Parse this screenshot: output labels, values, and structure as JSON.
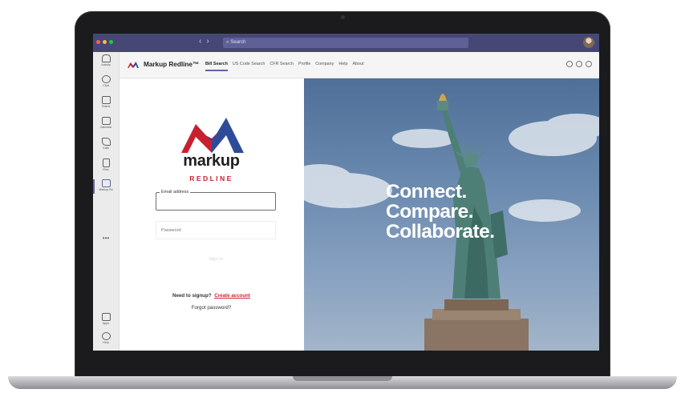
{
  "window": {
    "search_placeholder": "Search"
  },
  "rail": {
    "items": [
      {
        "label": "Activity",
        "icon": "bell-icon"
      },
      {
        "label": "Chat",
        "icon": "chat-icon"
      },
      {
        "label": "Teams",
        "icon": "teams-icon"
      },
      {
        "label": "Calendar",
        "icon": "calendar-icon"
      },
      {
        "label": "Calls",
        "icon": "phone-icon"
      },
      {
        "label": "Files",
        "icon": "file-icon"
      },
      {
        "label": "Markup Re",
        "icon": "markup-app-icon"
      }
    ],
    "bottom_items": [
      {
        "label": "Apps",
        "icon": "apps-icon"
      },
      {
        "label": "Help",
        "icon": "help-icon"
      }
    ]
  },
  "app": {
    "name": "Markup Redline™",
    "tabs": [
      "Bill Search",
      "US Code Search",
      "CFR Search",
      "Profile",
      "Company",
      "Help",
      "About"
    ],
    "active_tab": "Bill Search"
  },
  "login": {
    "brand_main": "markup",
    "brand_sub": "REDLINE",
    "email_label": "Email address",
    "password_placeholder": "Password",
    "signin_label": "Sign In",
    "signup_prompt": "Need to signup?",
    "signup_link": "Create account",
    "forgot_label": "Forgot password?"
  },
  "hero": {
    "tagline": [
      "Connect.",
      "Compare.",
      "Collaborate."
    ]
  },
  "colors": {
    "teams_purple": "#464775",
    "brand_red": "#c8202f",
    "brand_blue": "#2e4b9a"
  }
}
